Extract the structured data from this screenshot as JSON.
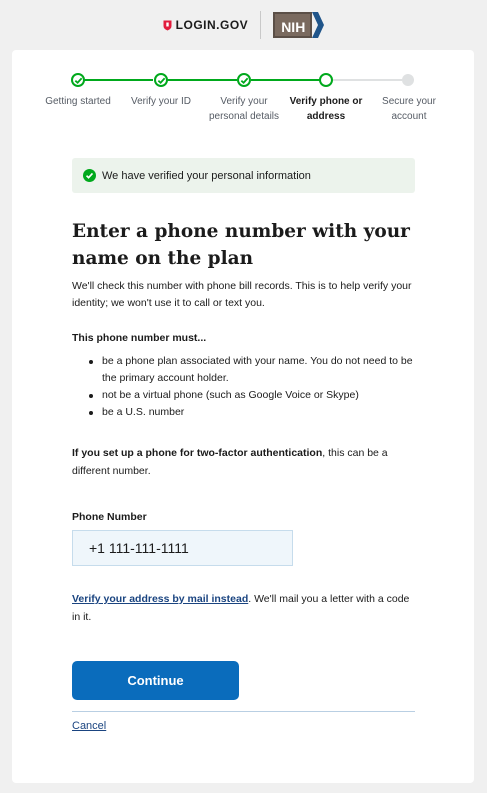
{
  "header": {
    "brand": "LOGIN.GOV",
    "partner": "NIH"
  },
  "stepper": {
    "steps": [
      {
        "label": "Getting started",
        "status": "done"
      },
      {
        "label": "Verify your ID",
        "status": "done"
      },
      {
        "label": "Verify your personal details",
        "status": "done"
      },
      {
        "label": "Verify phone or address",
        "status": "current"
      },
      {
        "label": "Secure your account",
        "status": "upcoming"
      }
    ]
  },
  "alert": {
    "text": "We have verified your personal information"
  },
  "page": {
    "title": "Enter a phone number with your name on the plan",
    "intro": "We'll check this number with phone bill records. This is to help verify your identity; we won't use it to call or text you.",
    "requirements_title": "This phone number must...",
    "requirements": [
      "be a phone plan associated with your name. You do not need to be the primary account holder.",
      "not be a virtual phone (such as Google Voice or Skype)",
      "be a U.S. number"
    ],
    "twofa_bold": "If you set up a phone for two-factor authentication",
    "twofa_rest": ", this can be a different number."
  },
  "form": {
    "phone_label": "Phone Number",
    "phone_value": "+1 111-111-1111"
  },
  "mail": {
    "link": "Verify your address by mail instead",
    "rest": ". We'll mail you a letter with a code in it."
  },
  "actions": {
    "continue": "Continue",
    "cancel": "Cancel"
  },
  "colors": {
    "success": "#00a91c",
    "primary_button": "#0a6cbc",
    "link": "#1a4480",
    "alert_bg": "#ecf3ec",
    "input_bg": "#eff6fb"
  }
}
